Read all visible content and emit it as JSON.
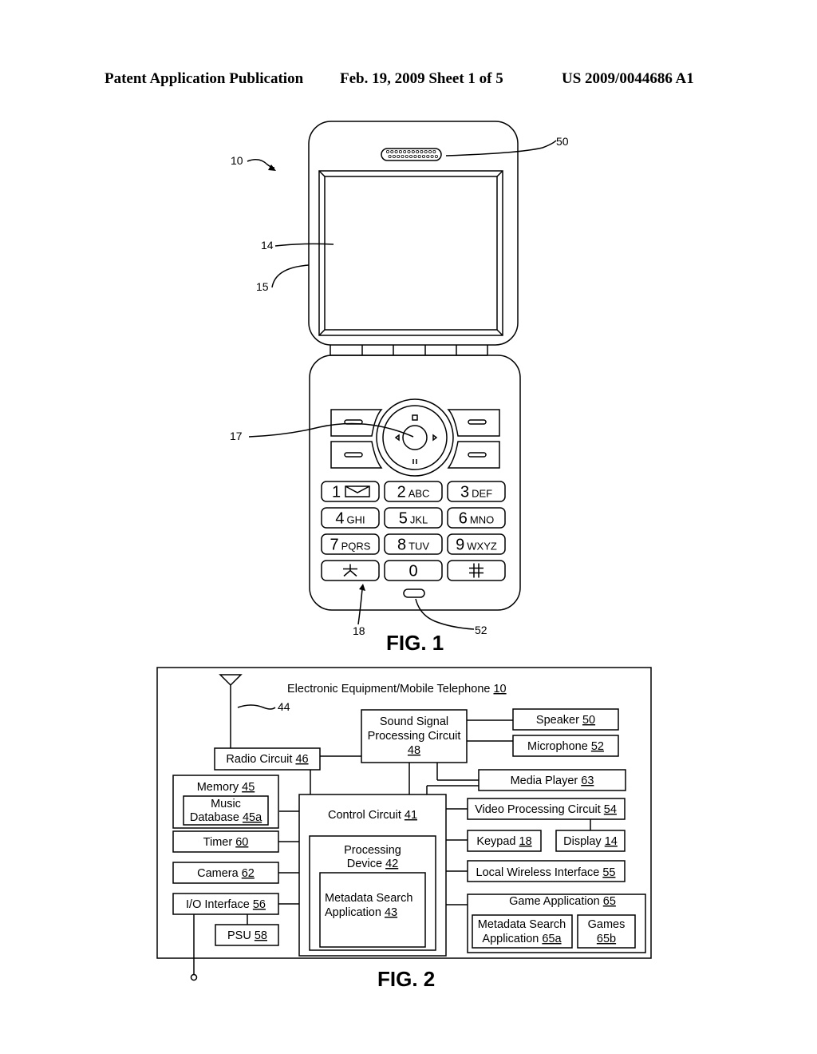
{
  "header": {
    "publication": "Patent Application Publication",
    "date_sheet": "Feb. 19, 2009   Sheet 1 of 5",
    "number": "US 2009/0044686 A1"
  },
  "fig1": {
    "caption": "FIG. 1",
    "refs": {
      "device": "10",
      "speaker": "50",
      "display": "14",
      "housing": "15",
      "nav": "17",
      "keypad": "18",
      "microphone": "52"
    },
    "keys": [
      {
        "digit": "1",
        "letters": "",
        "icon": "envelope-icon"
      },
      {
        "digit": "2",
        "letters": "ABC"
      },
      {
        "digit": "3",
        "letters": "DEF"
      },
      {
        "digit": "4",
        "letters": "GHI"
      },
      {
        "digit": "5",
        "letters": "JKL"
      },
      {
        "digit": "6",
        "letters": "MNO"
      },
      {
        "digit": "7",
        "letters": "PQRS"
      },
      {
        "digit": "8",
        "letters": "TUV"
      },
      {
        "digit": "9",
        "letters": "WXYZ"
      },
      {
        "digit": "*",
        "letters": "",
        "icon": "asterisk-icon"
      },
      {
        "digit": "0",
        "letters": ""
      },
      {
        "digit": "#",
        "letters": "",
        "icon": "hash-icon"
      }
    ]
  },
  "fig2": {
    "caption": "FIG. 2",
    "title": "Electronic Equipment/Mobile Telephone",
    "title_ref": "10",
    "antenna_ref": "44",
    "blocks": {
      "radio": {
        "label": "Radio Circuit",
        "ref": "46"
      },
      "sound": {
        "line1": "Sound Signal",
        "line2": "Processing Circuit",
        "ref": "48"
      },
      "speaker": {
        "label": "Speaker",
        "ref": "50"
      },
      "microphone": {
        "label": "Microphone",
        "ref": "52"
      },
      "media_player": {
        "label": "Media Player",
        "ref": "63"
      },
      "memory": {
        "label": "Memory",
        "ref": "45"
      },
      "music_db": {
        "line1": "Music",
        "line2": "Database",
        "ref": "45a"
      },
      "control": {
        "label": "Control Circuit",
        "ref": "41"
      },
      "processing": {
        "line1": "Processing",
        "line2": "Device",
        "ref": "42"
      },
      "metadata_app": {
        "line1": "Metadata Search",
        "line2": "Application",
        "ref": "43"
      },
      "timer": {
        "label": "Timer",
        "ref": "60"
      },
      "camera": {
        "label": "Camera",
        "ref": "62"
      },
      "io": {
        "label": "I/O Interface",
        "ref": "56"
      },
      "psu": {
        "label": "PSU",
        "ref": "58"
      },
      "video": {
        "label": "Video Processing Circuit",
        "ref": "54"
      },
      "keypad": {
        "label": "Keypad",
        "ref": "18"
      },
      "display": {
        "label": "Display",
        "ref": "14"
      },
      "wireless": {
        "label": "Local Wireless Interface",
        "ref": "55"
      },
      "game_app": {
        "label": "Game Application",
        "ref": "65"
      },
      "game_meta": {
        "line1": "Metadata Search",
        "line2": "Application",
        "ref": "65a"
      },
      "games": {
        "line1": "Games",
        "ref": "65b"
      }
    }
  }
}
